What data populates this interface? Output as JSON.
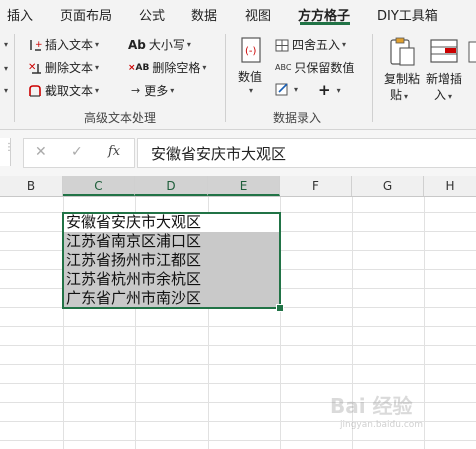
{
  "ribbon_tabs": [
    {
      "label": "插入"
    },
    {
      "label": "页面布局"
    },
    {
      "label": "公式"
    },
    {
      "label": "数据"
    },
    {
      "label": "视图"
    },
    {
      "label": "方方格子"
    },
    {
      "label": "DIY工具箱"
    }
  ],
  "active_tab": "方方格子",
  "ribbon": {
    "insert_text": "插入文本",
    "delete_text": "删除文本",
    "extract_text": "截取文本",
    "case": "大小写",
    "delete_space": "删除空格",
    "more": "更多",
    "group_advanced_text": "高级文本处理",
    "values": "数值",
    "round": "四舍五入",
    "keep_values": "只保留数值",
    "plus_sign": "+",
    "group_data_entry": "数据录入",
    "copy_paste_1": "复制粘",
    "copy_paste_2": "贴",
    "add_insert_1": "新增插",
    "add_insert_2": "入",
    "icon_ab": "Ab",
    "icon_abc": "ABC",
    "icon_ab_small": "AB"
  },
  "formula_bar": {
    "cancel_icon": "✕",
    "enter_icon": "✓",
    "fx_label": "fx",
    "content": "安徽省安庆市大观区"
  },
  "columns": [
    "B",
    "C",
    "D",
    "E",
    "F",
    "G",
    "H"
  ],
  "cells": [
    "安徽省安庆市大观区",
    "江苏省南京区浦口区",
    "江苏省扬州市江都区",
    "江苏省杭州市余杭区",
    "广东省广州市南沙区"
  ],
  "watermark": {
    "main": "Bai 经验",
    "sub": "jingyan.baidu.com"
  },
  "colors": {
    "accent": "#217346",
    "selection_fill": "#c9c9c9",
    "ribbon_bg": "#f3f3f3"
  }
}
